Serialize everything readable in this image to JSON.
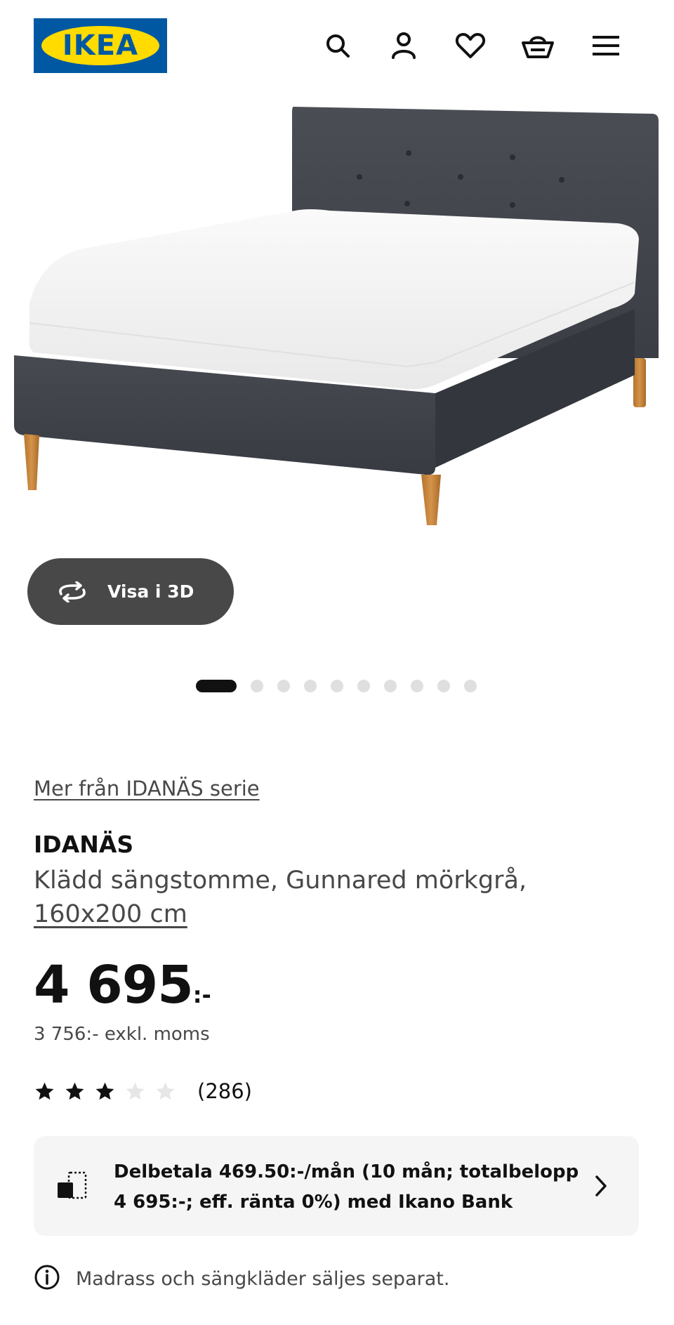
{
  "header": {
    "logo_text": "IKEA",
    "icons": [
      "search-icon",
      "user-icon",
      "heart-icon",
      "basket-icon",
      "menu-icon"
    ]
  },
  "gallery": {
    "view_3d_label": "Visa i 3D",
    "slide_count": 10,
    "active_slide": 1
  },
  "product": {
    "series_link": "Mer från IDANÄS serie",
    "name": "IDANÄS",
    "description": "Klädd sängstomme, Gunnared mörkgrå,",
    "size": "160x200 cm",
    "price_amount": "4 695",
    "price_suffix": ":-",
    "price_ex_vat": "3 756:- exkl. moms",
    "rating": 3,
    "rating_max": 5,
    "review_count": "(286)"
  },
  "finance": {
    "text": "Delbetala 469.50:-/mån (10 mån; totalbelopp 4 695:-; eff. ränta 0%) med Ikano Bank"
  },
  "note": {
    "text": "Madrass och sängkläder säljes separat."
  },
  "colors": {
    "ikea_blue": "#0058a3",
    "ikea_yellow": "#ffdb00",
    "pill_bg": "#484848",
    "panel_bg": "#f5f5f5",
    "text_dark": "#111111",
    "text_muted": "#484848"
  }
}
